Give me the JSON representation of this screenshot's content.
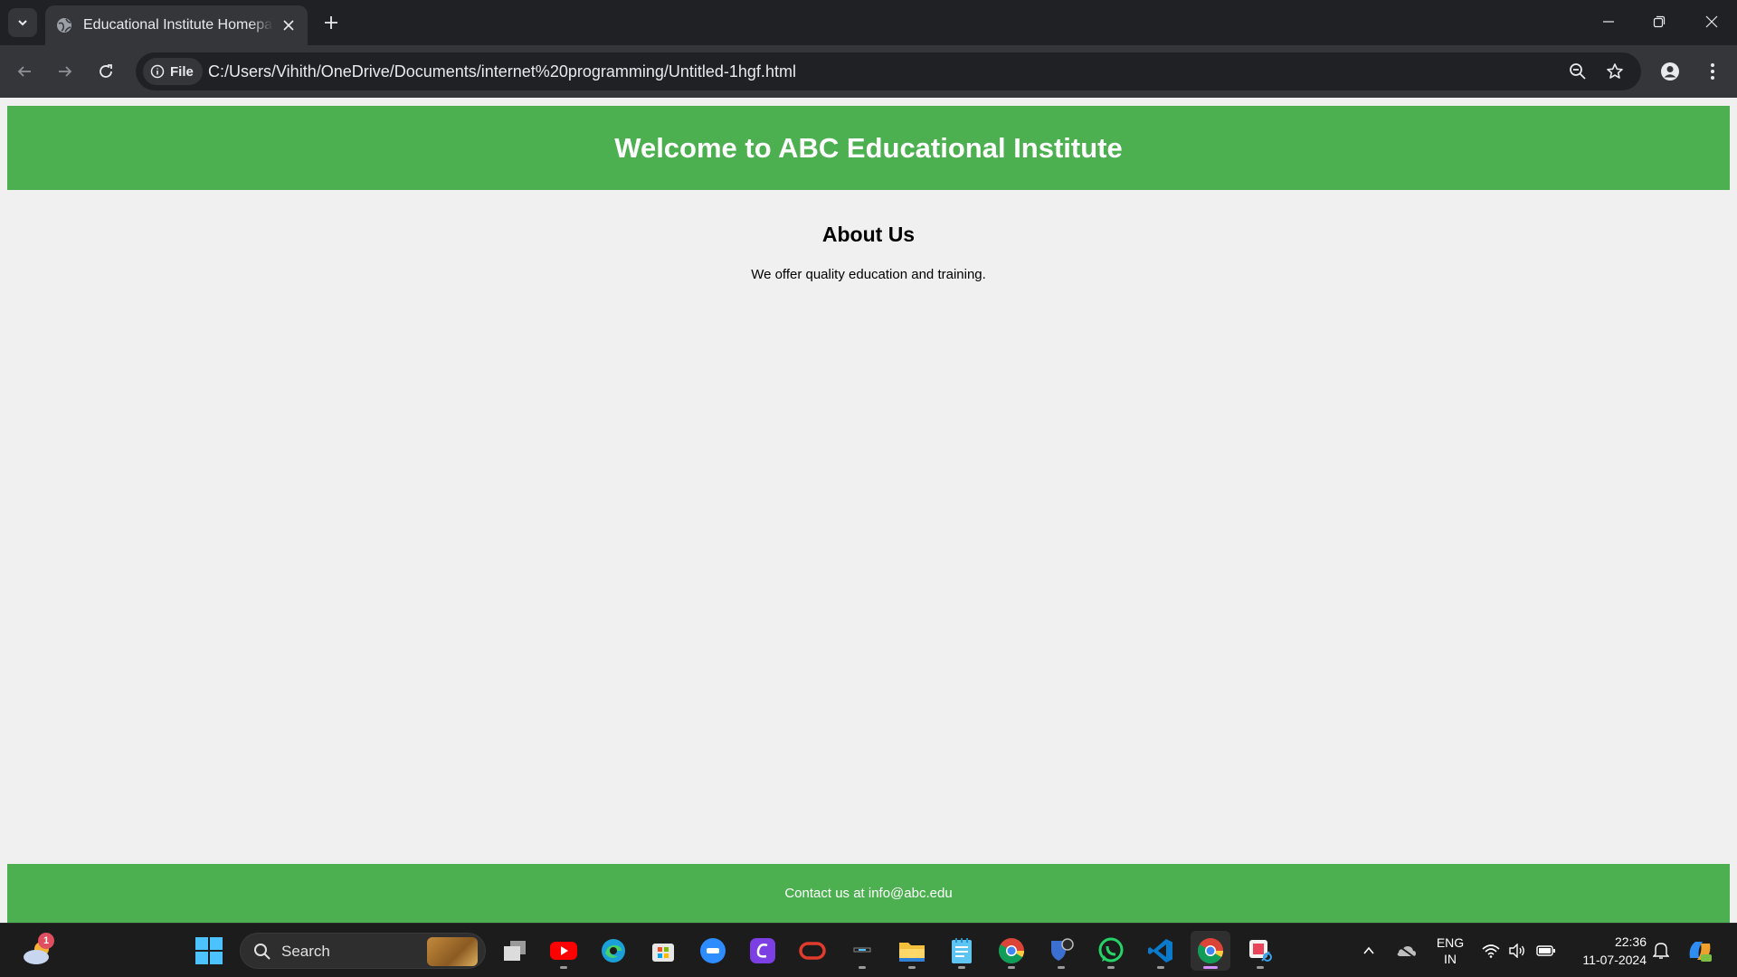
{
  "browser": {
    "tab": {
      "title": "Educational Institute Homepage",
      "icon": "globe-icon"
    },
    "address_bar": {
      "scheme_chip": "File",
      "url": "C:/Users/Vihith/OneDrive/Documents/internet%20programming/Untitled-1hgf.html"
    },
    "icons": [
      "tab-search-icon",
      "close-icon",
      "new-tab-icon",
      "minimize-icon",
      "restore-icon",
      "back-icon",
      "forward-icon",
      "reload-icon",
      "info-icon",
      "zoom-icon",
      "star-icon",
      "profile-icon",
      "menu-icon"
    ]
  },
  "page": {
    "header": {
      "title": "Welcome to ABC Educational Institute"
    },
    "about": {
      "heading": "About Us",
      "text": "We offer quality education and training."
    },
    "footer": {
      "text": "Contact us at info@abc.edu"
    },
    "colors": {
      "accent": "#4caf50",
      "background": "#f0f0f0",
      "header_text": "#ffffff"
    }
  },
  "taskbar": {
    "weather_badge": "1",
    "search_label": "Search",
    "apps": [
      "task-view",
      "youtube",
      "edge",
      "microsoft-store",
      "zoom",
      "canva",
      "oracle",
      "terminal",
      "file-explorer",
      "notepad",
      "chrome",
      "bitwarden",
      "whatsapp",
      "vscode",
      "chrome-active",
      "snipping-tool"
    ],
    "tray": {
      "lang_line1": "ENG",
      "lang_line2": "IN",
      "time": "22:36",
      "date": "11-07-2024"
    }
  }
}
